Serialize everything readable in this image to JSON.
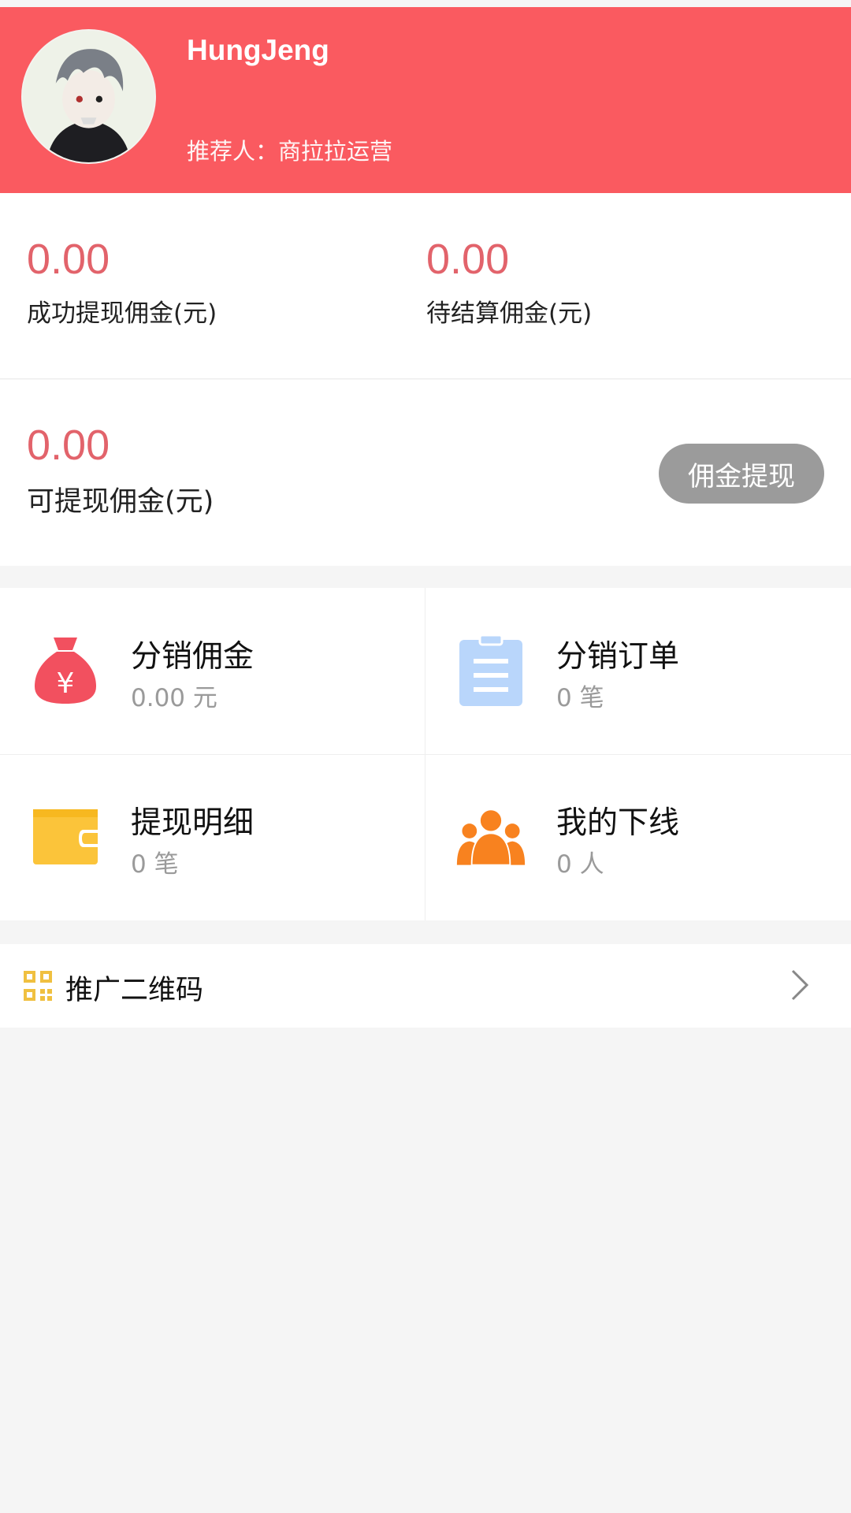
{
  "profile": {
    "username": "HungJeng",
    "referrer": "推荐人：商拉拉运营"
  },
  "stats": {
    "withdrawn": {
      "value": "0.00",
      "label": "成功提现佣金(元)"
    },
    "pending": {
      "value": "0.00",
      "label": "待结算佣金(元)"
    },
    "available": {
      "value": "0.00",
      "label": "可提现佣金(元)"
    },
    "withdraw_button": "佣金提现"
  },
  "grid": [
    {
      "title": "分销佣金",
      "sub": "0.00 元",
      "icon": "money-bag-icon",
      "color": "#f2505f"
    },
    {
      "title": "分销订单",
      "sub": "0 笔",
      "icon": "clipboard-icon",
      "color": "#b9d6fb"
    },
    {
      "title": "提现明细",
      "sub": "0 笔",
      "icon": "wallet-icon",
      "color": "#fbc43a"
    },
    {
      "title": "我的下线",
      "sub": "0 人",
      "icon": "team-icon",
      "color": "#f8821f"
    }
  ],
  "qr": {
    "label": "推广二维码",
    "icon": "qr-code-icon"
  },
  "colors": {
    "header": "#fa5a60",
    "value": "#e2636b",
    "button": "#9b9b9b"
  }
}
